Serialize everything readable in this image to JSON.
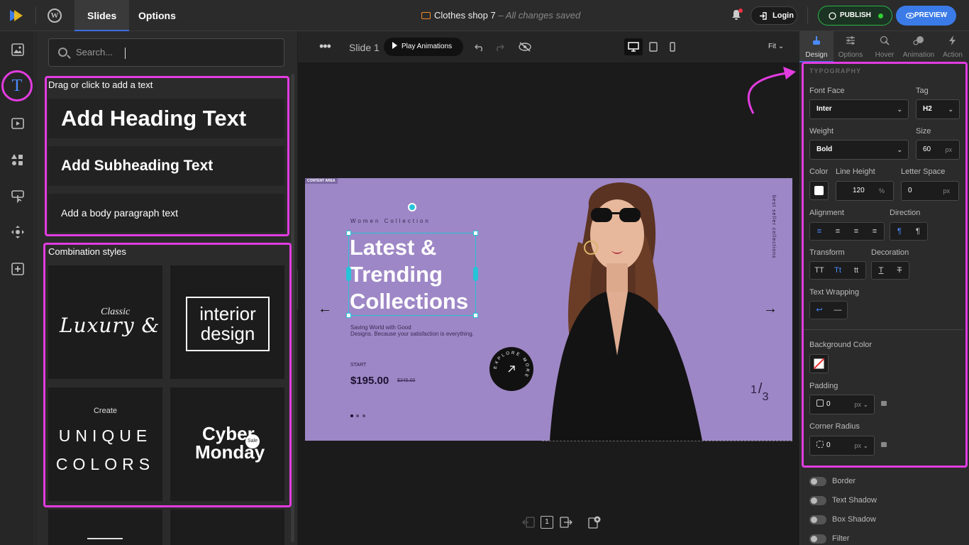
{
  "topbar": {
    "tabs": [
      "Slides",
      "Options"
    ],
    "doc_title": "Clothes shop 7",
    "doc_status": "– All changes saved",
    "login_label": "Login",
    "publish_label": "PUBLISH",
    "preview_label": "PREVIEW"
  },
  "left_panel": {
    "search_placeholder": "Search...",
    "text_section_label": "Drag or click to add a text",
    "heading_option": "Add Heading Text",
    "subheading_option": "Add Subheading Text",
    "body_option": "Add a body paragraph text",
    "combo_section_label": "Combination styles",
    "combo_tiles": {
      "classic_small": "Classic",
      "classic_big": "Luxury &",
      "interior": "interior design",
      "create": "Create",
      "unique": "UNIQUE",
      "colors": "COLORS",
      "cyber": "Cyber",
      "monday": "Monday",
      "sale": "Sale"
    }
  },
  "canvas_toolbar": {
    "slide_name": "Slide 1",
    "play_label": "Play Animations",
    "zoom": "Fit"
  },
  "slide": {
    "content_area": "CONTENT AREA",
    "eyebrow": "Women Collection",
    "headline_1": "Latest &",
    "headline_2": "Trending",
    "headline_3": "Collections",
    "subtext_1": "Saving World with Good",
    "subtext_2": "Designs. Because your satisfaction is everything.",
    "start_label": "START",
    "price": "$195.00",
    "old_price": "$345.00",
    "badge_text": "EXPLORE MORE",
    "side_text": "best seller collections",
    "page_current": "1",
    "page_sep": "/",
    "page_total": "3"
  },
  "bottom_nav": {
    "page_number": "1"
  },
  "right_panel": {
    "tabs": [
      "Design",
      "Options",
      "Hover",
      "Animation",
      "Action"
    ],
    "section_title": "TYPOGRAPHY",
    "font_face_label": "Font Face",
    "font_face_value": "Inter",
    "tag_label": "Tag",
    "tag_value": "H2",
    "weight_label": "Weight",
    "weight_value": "Bold",
    "size_label": "Size",
    "size_value": "60",
    "size_unit": "px",
    "color_label": "Color",
    "line_height_label": "Line Height",
    "line_height_value": "120",
    "line_height_unit": "%",
    "letter_space_label": "Letter Space",
    "letter_space_value": "0",
    "letter_space_unit": "px",
    "alignment_label": "Alignment",
    "direction_label": "Direction",
    "transform_label": "Transform",
    "transform_options": [
      "TT",
      "Tt",
      "tt"
    ],
    "decoration_label": "Decoration",
    "wrapping_label": "Text Wrapping",
    "bg_color_label": "Background Color",
    "padding_label": "Padding",
    "padding_value": "0",
    "padding_unit": "px",
    "radius_label": "Corner Radius",
    "radius_value": "0",
    "radius_unit": "px",
    "toggles": [
      "Border",
      "Text Shadow",
      "Box Shadow",
      "Filter"
    ]
  },
  "colors": {
    "accent": "#3a7be8",
    "highlight": "#e23ce0",
    "publish": "#2bb34a",
    "slide_bg": "#9e87c6"
  }
}
